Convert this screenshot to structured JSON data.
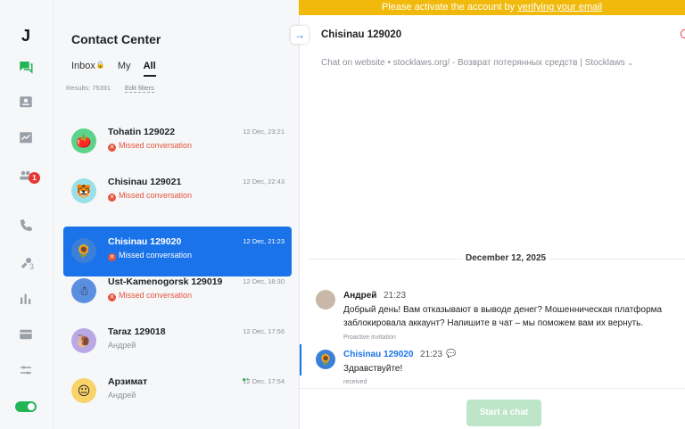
{
  "banner": {
    "text": "Please activate the account by",
    "link": "verifying your email"
  },
  "sidebar": {
    "logo": "J",
    "items": [
      {
        "icon": "chat-icon",
        "active": true
      },
      {
        "icon": "contacts-icon"
      },
      {
        "icon": "analytics-icon"
      },
      {
        "icon": "team-icon",
        "badge": "1"
      },
      {
        "icon": "phone-icon"
      },
      {
        "icon": "integrations-icon",
        "count": "3"
      },
      {
        "icon": "bar-chart-icon"
      },
      {
        "icon": "billing-icon"
      },
      {
        "icon": "settings-sliders-icon"
      }
    ],
    "status_toggle": "on"
  },
  "list": {
    "title": "Contact Center",
    "tabs": [
      {
        "label": "Inbox"
      },
      {
        "label": "My"
      },
      {
        "label": "All"
      }
    ],
    "results": "Results: 75391",
    "edit_filters": "Edit filters",
    "conversations": [
      {
        "name": "Tohatin 129022",
        "date": "12 Dec, 23:21",
        "status": "Missed conversation",
        "avatar": "🍅",
        "avatar_bg": "#5bd38a"
      },
      {
        "name": "Chisinau 129021",
        "date": "12 Dec, 22:43",
        "status": "Missed conversation",
        "avatar": "🐯",
        "avatar_bg": "#9be0e8"
      },
      {
        "name": "Chisinau 129020",
        "date": "12 Dec, 21:23",
        "status": "Missed conversation",
        "avatar": "🌻",
        "avatar_bg": "#3b7fd8"
      },
      {
        "name": "Ust-Kamenogorsk 129019",
        "date": "12 Dec, 18:30",
        "status": "Missed conversation",
        "avatar": "☃",
        "avatar_bg": "#5b8fe0"
      },
      {
        "name": "Taraz 129018",
        "date": "12 Dec, 17:56",
        "status": "Андрей",
        "avatar": "🐌",
        "avatar_bg": "#b9a8e6"
      },
      {
        "name": "Арзимат",
        "date": "12 Dec, 17:54",
        "status": "Андрей",
        "avatar": "😐",
        "avatar_bg": "#f8d36a"
      }
    ]
  },
  "chat": {
    "title": "Chisinau 129020",
    "subtitle": "Chat on website • stocklaws.org/ - Возврат потерянных средств | Stocklaws",
    "date_separator": "December 12, 2025",
    "messages": [
      {
        "author": "Андрей",
        "time": "21:23",
        "text": "Добрый день! Вам отказывают в выводе денег? Мошенническая платформа заблокировала аккаунт? Напишите в чат – мы поможем вам их вернуть.",
        "meta": "Proactive invitation"
      },
      {
        "author": "Chisinau 129020",
        "time": "21:23",
        "text": "Здравствуйте!",
        "meta": "received"
      }
    ],
    "start_button": "Start a chat"
  }
}
